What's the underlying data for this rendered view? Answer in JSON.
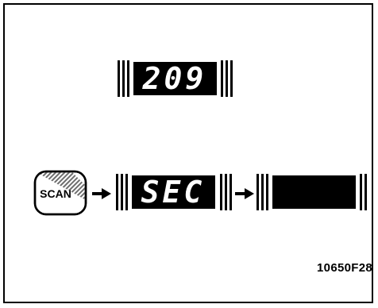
{
  "top_display": {
    "text": "209"
  },
  "scan_button": {
    "label": "SCAN"
  },
  "second_display": {
    "text": "SEC"
  },
  "third_display": {
    "text": ""
  },
  "figure_code": "10650F28",
  "colors": {
    "display_bg": "#000000",
    "segment": "#ffffff",
    "line": "#000000"
  }
}
